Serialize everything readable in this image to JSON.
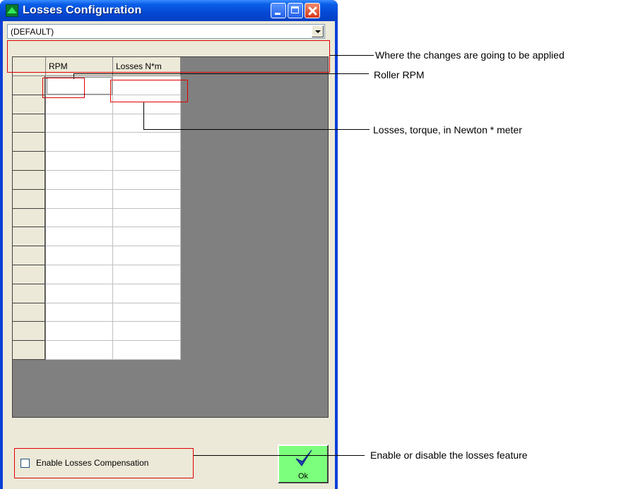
{
  "window": {
    "title": "Losses Configuration",
    "app_icon": "app-logo-icon",
    "controls": [
      "minimize-icon",
      "maximize-icon",
      "close-icon"
    ]
  },
  "profile_select": {
    "value": "(DEFAULT)"
  },
  "losses_table": {
    "columns": [
      "RPM",
      "Losses N*m"
    ],
    "row_count": 15,
    "rows": []
  },
  "enable_compensation": {
    "label": "Enable Losses Compensation",
    "checked": false
  },
  "ok_button": {
    "label": "Ok",
    "icon": "checkmark-icon"
  },
  "annotations": {
    "profile": "Where the changes are going to be applied",
    "rpm": "Roller RPM",
    "losses": "Losses, torque, in Newton * meter",
    "enable": "Enable or disable the losses feature"
  },
  "colors": {
    "annotation_highlight": "#e00000",
    "ok_button": "#7cff7c",
    "grid_background": "#808080"
  }
}
